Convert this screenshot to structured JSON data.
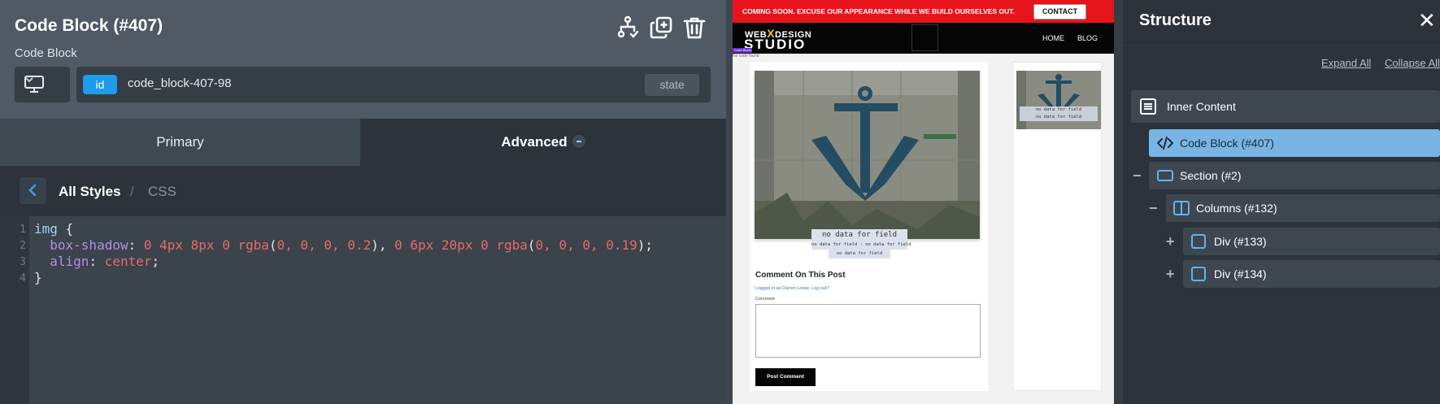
{
  "element_panel": {
    "title": "Code Block (#407)",
    "subtitle": "Code Block",
    "icons": [
      "structure-tree-icon",
      "duplicate-icon",
      "trash-icon"
    ],
    "id_label": "id",
    "id_value": "code_block-407-98",
    "state_label": "state",
    "device_icon": "monitor-icon"
  },
  "tabs": {
    "primary": "Primary",
    "advanced": "Advanced"
  },
  "breadcrumb": {
    "all_styles": "All Styles",
    "separator": "/",
    "current": "CSS"
  },
  "code": {
    "line_numbers": [
      "1",
      "2",
      "3",
      "4"
    ],
    "l1_selector": "img",
    "l1_brace": " {",
    "l2_prop": "box-shadow",
    "l2_colon": ": ",
    "l2_v1": "0 4px 8px 0 ",
    "l2_fn1": "rgba",
    "l2_p1": "(",
    "l2_args1": "0, 0, 0, 0.2",
    "l2_p2": "), ",
    "l2_v2": "0 6px 20px 0 ",
    "l2_fn2": "rgba",
    "l2_p3": "(",
    "l2_args2": "0, 0, 0, 0.19",
    "l2_p4": ");",
    "l3_prop": "align",
    "l3_colon": ": ",
    "l3_val": "center",
    "l3_semi": ";",
    "l4": "}"
  },
  "preview": {
    "banner_text": "COMING SOON. EXCUSE OUR APPEARANCE WHILE WE BUILD OURSELVES OUT.",
    "contact_label": "CONTACT",
    "logo_top_a": "WEB",
    "logo_top_x": "X",
    "logo_top_b": "DESIGN",
    "logo_bottom": "STUDIO",
    "nav_home": "HOME",
    "nav_blog": "BLOG",
    "tag_label": "Code Block",
    "no_code_text": "No code found",
    "no_data_main": "no data for field",
    "no_data_small_1": "no data for field",
    "no_data_sep": ":",
    "no_data_small_2": "no data for field",
    "no_data_small_3": "no data for field",
    "side_no_data_1": "no data for field",
    "side_no_data_2": "no data for field",
    "comment_title": "Comment On This Post",
    "logged_in_text": "Logged in as Darren Locke. Log out?",
    "comment_label": "Comment",
    "post_button": "Post Comment"
  },
  "structure": {
    "title": "Structure",
    "close_icon": "close-icon",
    "expand_all": "Expand All",
    "collapse_all": "Collapse All",
    "items": [
      {
        "label": "Inner Content",
        "icon": "inner-content-icon"
      },
      {
        "label": "Code Block (#407)",
        "icon": "code-icon"
      },
      {
        "label": "Section (#2)",
        "icon": "section-icon",
        "toggle": "−"
      },
      {
        "label": "Columns (#132)",
        "icon": "columns-icon",
        "toggle": "−"
      },
      {
        "label": "Div (#133)",
        "icon": "div-icon",
        "toggle": "+"
      },
      {
        "label": "Div (#134)",
        "icon": "div-icon",
        "toggle": "+"
      }
    ]
  },
  "colors": {
    "panel_dark": "#2c333b",
    "panel_header": "#4f5a64",
    "accent_blue": "#1e9bea",
    "selected_row": "#79b5e4",
    "banner_red": "#e8141b"
  }
}
